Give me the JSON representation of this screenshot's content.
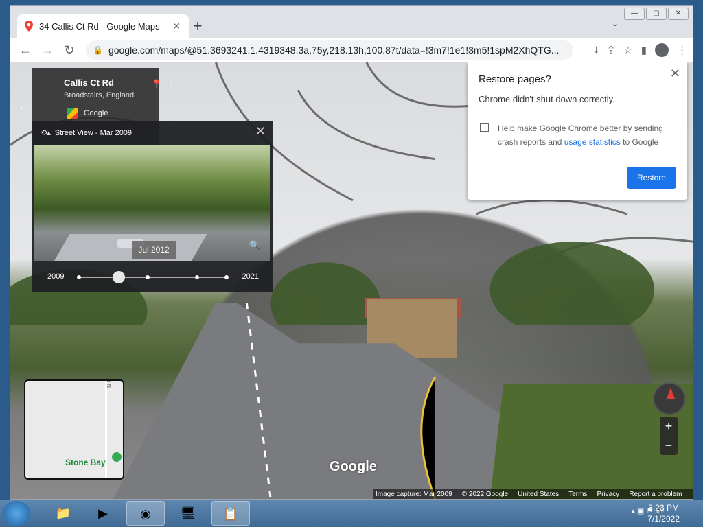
{
  "browser": {
    "tab": {
      "title": "34 Callis Ct Rd - Google Maps",
      "close": "✕"
    },
    "new_tab": "+",
    "url": "google.com/maps/@51.3693241,1.4319348,3a,75y,218.13h,100.87t/data=!3m7!1e1!3m5!1spM2XhQTG...",
    "window_controls": [
      "—",
      "▢",
      "✕"
    ]
  },
  "streetview_card": {
    "title": "Callis Ct Rd",
    "subtitle": "Broadstairs, England",
    "source": "Google",
    "back": "←"
  },
  "time_machine": {
    "header": "Street View - Mar 2009",
    "tooltip": "Jul 2012",
    "start_year": "2009",
    "end_year": "2021",
    "close": "✕"
  },
  "restore_dialog": {
    "title": "Restore pages?",
    "message": "Chrome didn't shut down correctly.",
    "help_text": "Help make Google Chrome better by sending crash reports and",
    "help_link": "usage statistics",
    "help_suffix": "to Google",
    "button": "Restore",
    "close": "✕"
  },
  "minimap": {
    "street_label": "N Foreland",
    "place_label": "Stone Bay"
  },
  "zoom": {
    "in": "+",
    "out": "−"
  },
  "logo": "Google",
  "footer": [
    "Image capture: Mar 2009",
    "© 2022 Google",
    "United States",
    "Terms",
    "Privacy",
    "Report a problem"
  ],
  "taskbar": {
    "time": "3:23 PM",
    "date": "7/1/2022"
  }
}
